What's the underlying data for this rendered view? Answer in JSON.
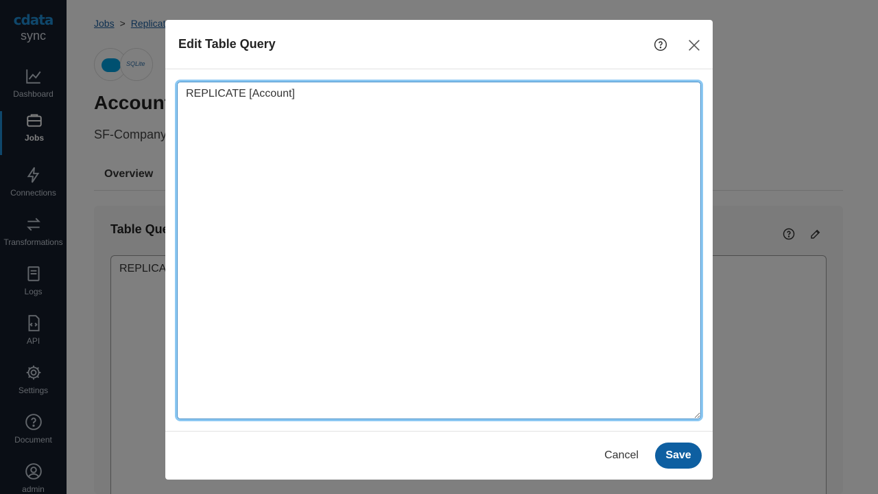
{
  "app": {
    "logo_mark": "cdata",
    "logo_sub": "sync"
  },
  "sidebar": {
    "items": [
      {
        "label": "Dashboard",
        "icon": "chart-line-icon"
      },
      {
        "label": "Jobs",
        "icon": "briefcase-icon",
        "active": true
      },
      {
        "label": "Connections",
        "icon": "lightning-icon"
      },
      {
        "label": "Transformations",
        "icon": "arrows-swap-icon"
      },
      {
        "label": "Logs",
        "icon": "book-icon"
      },
      {
        "label": "API",
        "icon": "code-file-icon"
      },
      {
        "label": "Settings",
        "icon": "gear-icon"
      },
      {
        "label": "Document",
        "icon": "question-circle-icon"
      },
      {
        "label": "admin",
        "icon": "user-circle-icon"
      }
    ]
  },
  "breadcrumb": {
    "items": [
      "Jobs",
      "Replicat"
    ],
    "separator": ">"
  },
  "connections": {
    "source_text": "SQLite"
  },
  "page": {
    "title": "Account",
    "subtitle": "SF-Company.A",
    "tabs": [
      "Overview"
    ],
    "card_title": "Table Que",
    "card_query": "REPLICAT"
  },
  "modal": {
    "title": "Edit Table Query",
    "query": "REPLICATE [Account]",
    "cancel_label": "Cancel",
    "save_label": "Save"
  },
  "colors": {
    "sidebar_bg": "#141c2b",
    "accent": "#1f8fd6",
    "save_button": "#0e5fa1"
  }
}
